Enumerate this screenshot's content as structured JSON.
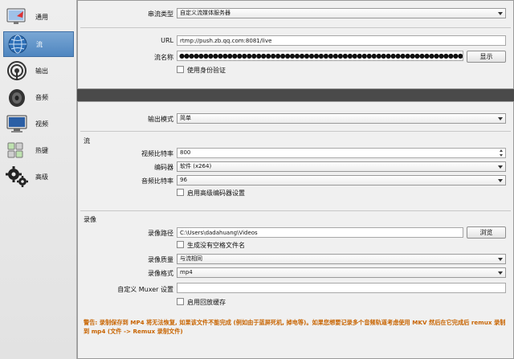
{
  "sidebar": {
    "items": [
      {
        "label": "通用",
        "icon": "general-monitor-icon"
      },
      {
        "label": "流",
        "icon": "stream-globe-icon"
      },
      {
        "label": "输出",
        "icon": "output-broadcast-icon"
      },
      {
        "label": "音频",
        "icon": "audio-speaker-icon"
      },
      {
        "label": "视频",
        "icon": "video-monitor-icon"
      },
      {
        "label": "热键",
        "icon": "hotkey-keyboard-icon"
      },
      {
        "label": "高级",
        "icon": "advanced-gears-icon"
      }
    ]
  },
  "stream": {
    "type_label": "串流类型",
    "type_value": "自定义流媒体服务器",
    "url_label": "URL",
    "url_value": "rtmp://push.zb.qq.com:8081/live",
    "key_label": "流名称",
    "key_value": "●●●●●●●●●●●●●●●●●●●●●●●●●●●●●●●●●●●●●●●●●●●●●●●●●●●●●●●●●●●●●●●●●●●●●●●●",
    "show_button": "显示",
    "auth_label": "使用身份验证"
  },
  "output": {
    "mode_label": "输出模式",
    "mode_value": "简单",
    "stream_section": "流",
    "video_bitrate_label": "视频比特率",
    "video_bitrate_value": "800",
    "encoder_label": "编码器",
    "encoder_value": "软件 (x264)",
    "audio_bitrate_label": "音频比特率",
    "audio_bitrate_value": "96",
    "advanced_encoder_label": "启用高级编码器设置",
    "recording_section": "录像",
    "rec_path_label": "录像路径",
    "rec_path_value": "C:\\Users\\dadahuang\\Videos",
    "browse_button": "浏览",
    "no_space_label": "生成没有空格文件名",
    "rec_quality_label": "录像质量",
    "rec_quality_value": "与流相同",
    "rec_format_label": "录像格式",
    "rec_format_value": "mp4",
    "muxer_label": "自定义 Muxer 设置",
    "muxer_value": "",
    "replay_label": "启用回放缓存",
    "warning": "警告: 录制保存到 MP4 将无法恢复, 如果该文件不能完成 (例如由于蓝屏死机, 掉电等)。如果您想要记录多个音频轨道考虑使用 MKV 然后在它完成后 remux 录制到 mp4 (文件 -> Remux 录制文件)"
  },
  "colors": {
    "accent": "#4f86c0",
    "warning": "#c86400",
    "background": "#4a4a4a"
  }
}
